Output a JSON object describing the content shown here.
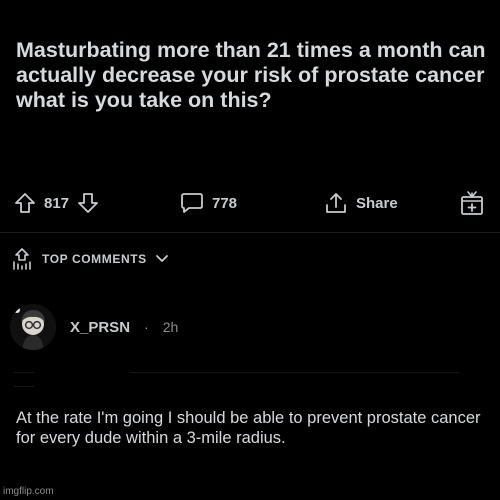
{
  "post": {
    "title": "Masturbating more than 21 times a month can actually decrease your risk of prostate cancer what is you take on this?"
  },
  "actions": {
    "upvotes": "817",
    "comments": "778",
    "share_label": "Share"
  },
  "top_comments_label": "TOP COMMENTS",
  "comment": {
    "username": "X_PRSN",
    "separator": "·",
    "age": "2h",
    "body": "At the rate I'm going I should be able to prevent prostate cancer for every dude within a 3-mile radius."
  },
  "watermark": "imgflip.com",
  "colors": {
    "background": "#000000",
    "text": "#d7dadc",
    "muted": "#8a8c8e"
  }
}
